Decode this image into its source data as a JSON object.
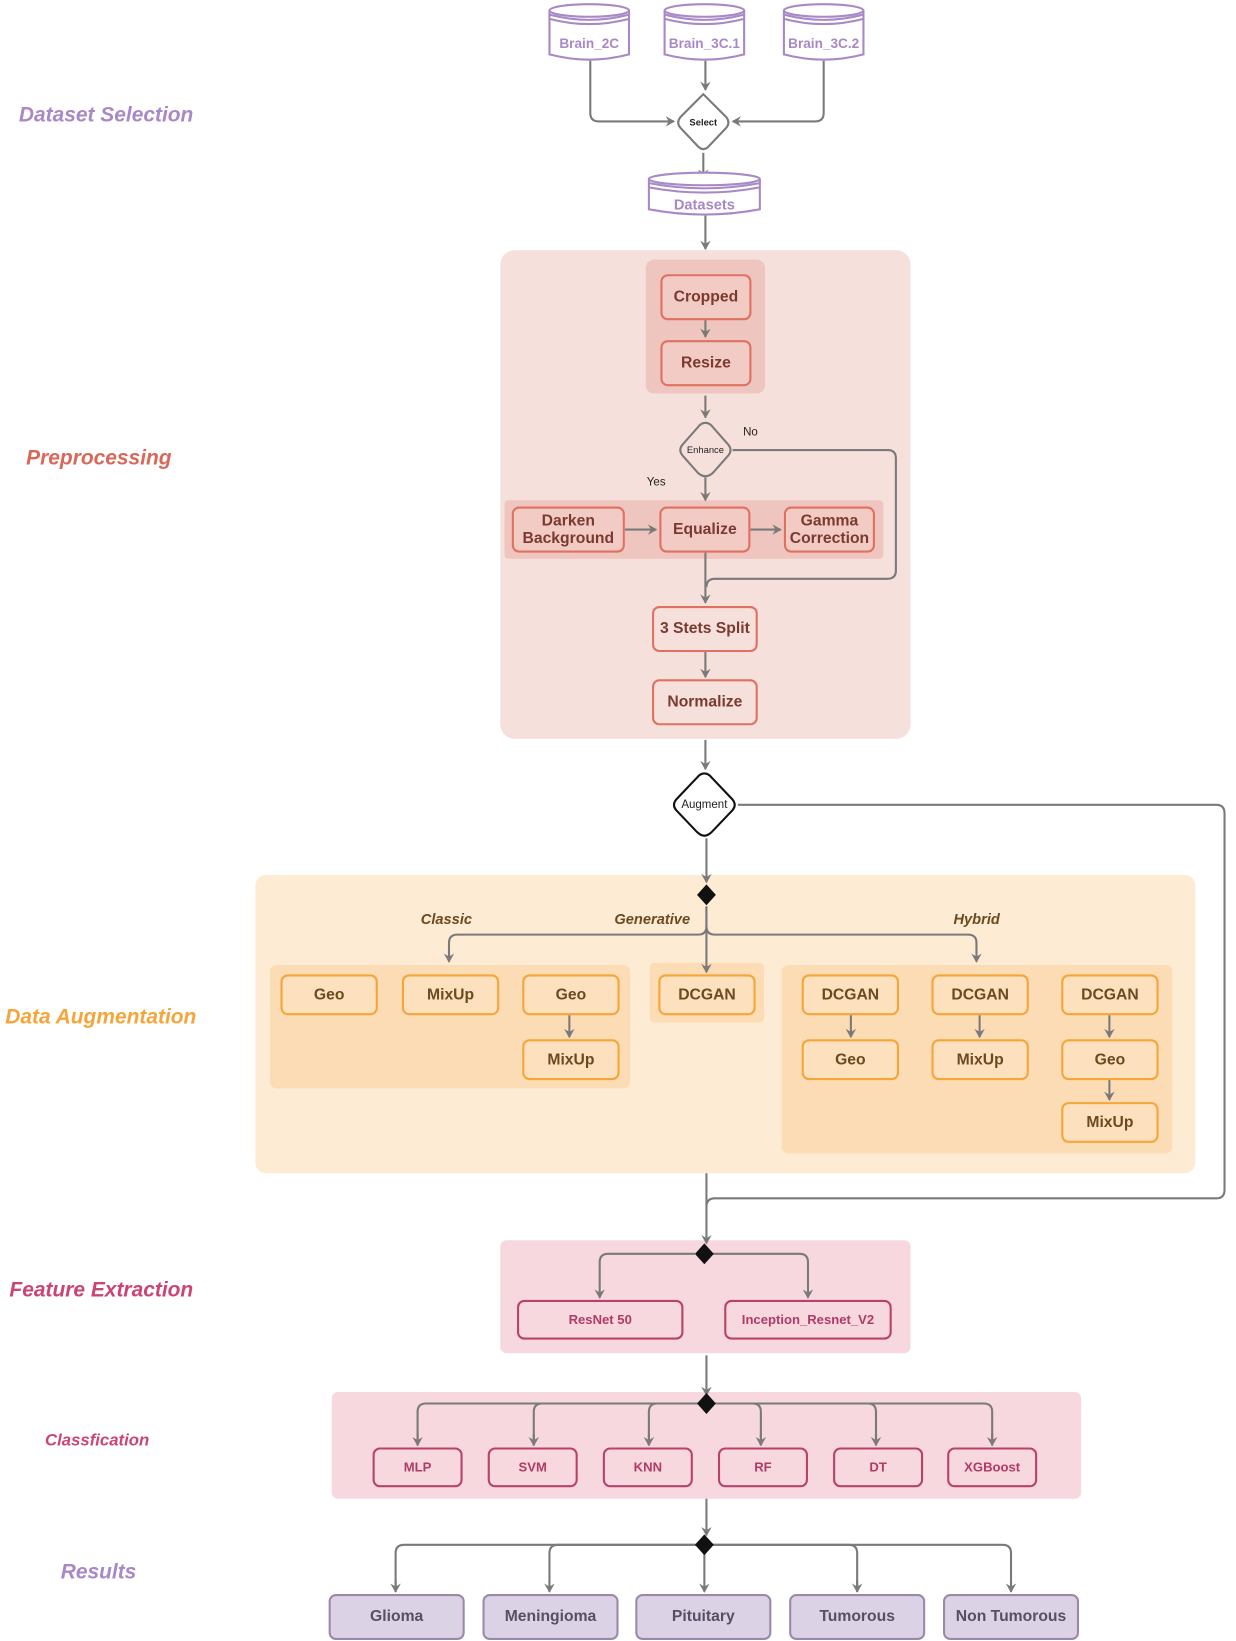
{
  "stages": {
    "dataset_selection": "Dataset Selection",
    "preprocessing": "Preprocessing",
    "data_augmentation": "Data Augmentation",
    "feature_extraction": "Feature Extraction",
    "classification": "Classfication",
    "results": "Results"
  },
  "colors": {
    "dataset": "#a888c6",
    "preprocessing": "#d9685a",
    "augmentation": "#f5a53a",
    "feature": "#cc4470",
    "results": "#a888c6",
    "wire": "#7a7a7a"
  },
  "dataset_selection": {
    "sources": [
      "Brain_2C",
      "Brain_3C.1",
      "Brain_3C.2"
    ],
    "decision": "Select",
    "output": "Datasets"
  },
  "preprocessing": {
    "group1": [
      "Cropped",
      "Resize"
    ],
    "decision": "Enhance",
    "yes_label": "Yes",
    "no_label": "No",
    "enhance_steps": [
      "Darken Background",
      "Equalize",
      "Gamma Correction"
    ],
    "split": "3 Stets Split",
    "normalize": "Normalize"
  },
  "augmentation": {
    "decision": "Augment",
    "branches": {
      "classic": "Classic",
      "generative": "Generative",
      "hybrid": "Hybrid"
    },
    "classic": {
      "geo": "Geo",
      "mixup": "MixUp",
      "combo": [
        "Geo",
        "MixUp"
      ]
    },
    "generative": [
      "DCGAN"
    ],
    "hybrid": {
      "chain1": [
        "DCGAN",
        "Geo"
      ],
      "chain2": [
        "DCGAN",
        "MixUp"
      ],
      "chain3": [
        "DCGAN",
        "Geo",
        "MixUp"
      ]
    }
  },
  "feature_extraction": {
    "models": [
      "ResNet 50",
      "Inception_Resnet_V2"
    ]
  },
  "classification": {
    "models": [
      "MLP",
      "SVM",
      "KNN",
      "RF",
      "DT",
      "XGBoost"
    ]
  },
  "results": {
    "classes": [
      "Glioma",
      "Meningioma",
      "Pituitary",
      "Tumorous",
      "Non Tumorous"
    ]
  }
}
